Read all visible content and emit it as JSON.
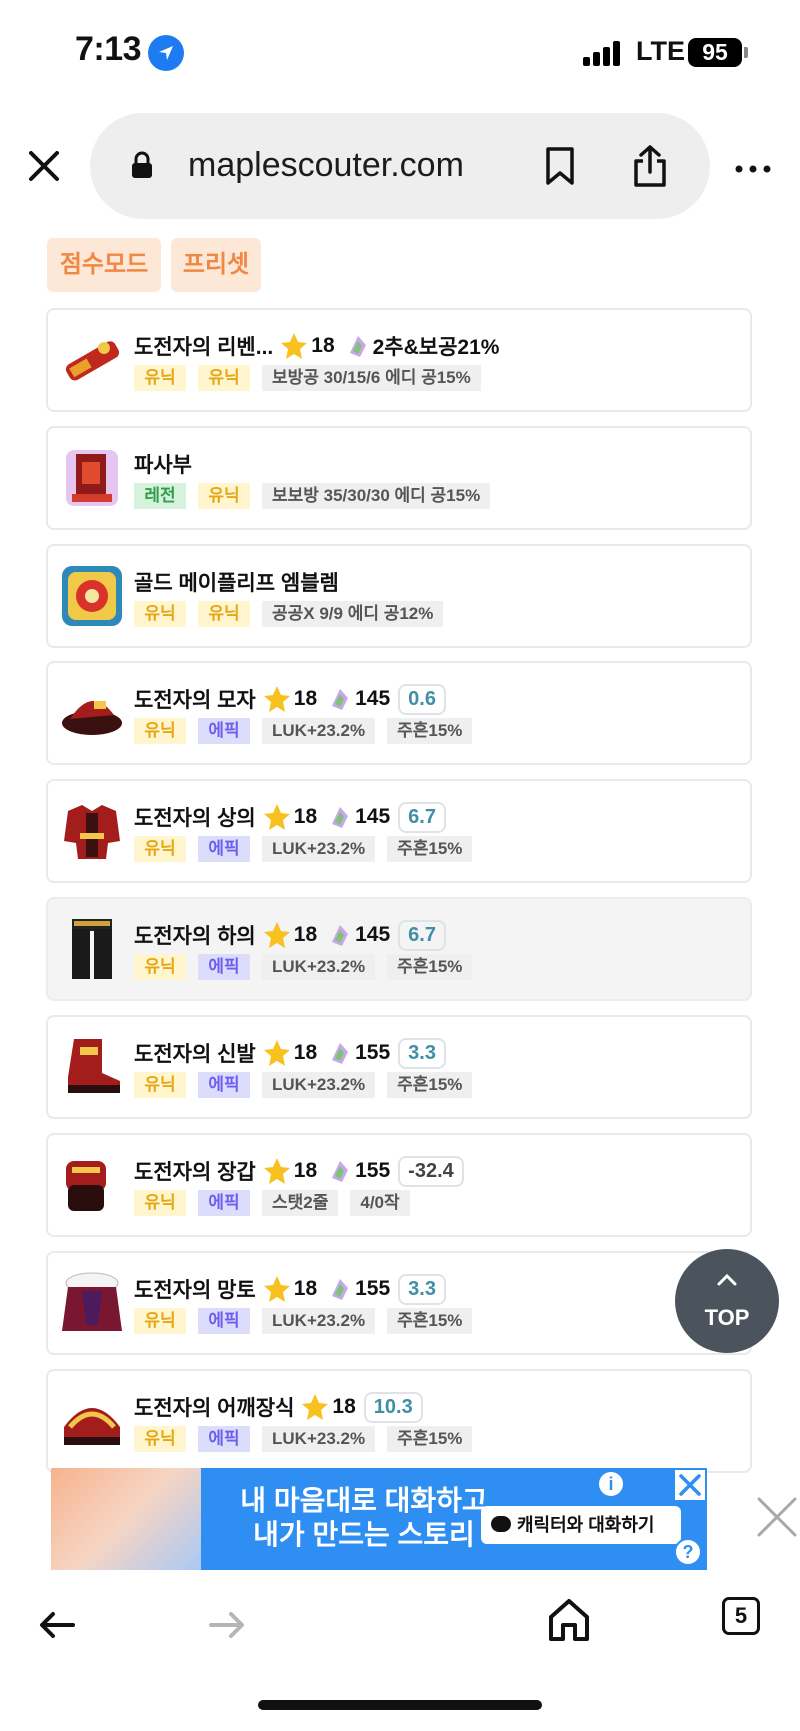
{
  "status_bar": {
    "time": "7:13",
    "network": "LTE",
    "battery": "95"
  },
  "browser": {
    "url": "maplescouter.com",
    "tab_count": "5"
  },
  "modes": [
    {
      "label": "점수모드"
    },
    {
      "label": "프리셋"
    }
  ],
  "items": [
    {
      "name": "도전자의 리벤...",
      "icon": "weapon-icon",
      "star": "18",
      "gem": "",
      "extra": "2추&보공21%",
      "score": "",
      "tags": [
        {
          "text": "유닉",
          "type": "unique"
        },
        {
          "text": "유닉",
          "type": "unique"
        },
        {
          "text": "보방공 30/15/6 에디 공15%",
          "type": "info"
        }
      ]
    },
    {
      "name": "파사부",
      "icon": "secondary-weapon-icon",
      "star": "",
      "gem": "",
      "extra": "",
      "score": "",
      "tags": [
        {
          "text": "레전",
          "type": "legend"
        },
        {
          "text": "유닉",
          "type": "unique"
        },
        {
          "text": "보보방 35/30/30 에디 공15%",
          "type": "info"
        }
      ]
    },
    {
      "name": "골드 메이플리프 엠블렘",
      "icon": "emblem-icon",
      "star": "",
      "gem": "",
      "extra": "",
      "score": "",
      "tags": [
        {
          "text": "유닉",
          "type": "unique"
        },
        {
          "text": "유닉",
          "type": "unique"
        },
        {
          "text": "공공X 9/9 에디 공12%",
          "type": "info"
        }
      ]
    },
    {
      "name": "도전자의 모자",
      "icon": "hat-icon",
      "star": "18",
      "gem": "145",
      "extra": "",
      "score": "0.6",
      "tags": [
        {
          "text": "유닉",
          "type": "unique"
        },
        {
          "text": "에픽",
          "type": "epic"
        },
        {
          "text": "LUK+23.2%",
          "type": "info"
        },
        {
          "text": "주흔15%",
          "type": "info"
        }
      ]
    },
    {
      "name": "도전자의 상의",
      "icon": "top-armor-icon",
      "star": "18",
      "gem": "145",
      "extra": "",
      "score": "6.7",
      "tags": [
        {
          "text": "유닉",
          "type": "unique"
        },
        {
          "text": "에픽",
          "type": "epic"
        },
        {
          "text": "LUK+23.2%",
          "type": "info"
        },
        {
          "text": "주흔15%",
          "type": "info"
        }
      ]
    },
    {
      "name": "도전자의 하의",
      "icon": "bottom-armor-icon",
      "star": "18",
      "gem": "145",
      "extra": "",
      "score": "6.7",
      "tags": [
        {
          "text": "유닉",
          "type": "unique"
        },
        {
          "text": "에픽",
          "type": "epic"
        },
        {
          "text": "LUK+23.2%",
          "type": "info"
        },
        {
          "text": "주흔15%",
          "type": "info"
        }
      ]
    },
    {
      "name": "도전자의 신발",
      "icon": "shoes-icon",
      "star": "18",
      "gem": "155",
      "extra": "",
      "score": "3.3",
      "tags": [
        {
          "text": "유닉",
          "type": "unique"
        },
        {
          "text": "에픽",
          "type": "epic"
        },
        {
          "text": "LUK+23.2%",
          "type": "info"
        },
        {
          "text": "주흔15%",
          "type": "info"
        }
      ]
    },
    {
      "name": "도전자의 장갑",
      "icon": "gloves-icon",
      "star": "18",
      "gem": "155",
      "extra": "",
      "score": "-32.4",
      "tags": [
        {
          "text": "유닉",
          "type": "unique"
        },
        {
          "text": "에픽",
          "type": "epic"
        },
        {
          "text": "스탯2줄",
          "type": "info"
        },
        {
          "text": "4/0작",
          "type": "info"
        }
      ]
    },
    {
      "name": "도전자의 망토",
      "icon": "cape-icon",
      "star": "18",
      "gem": "155",
      "extra": "",
      "score": "3.3",
      "tags": [
        {
          "text": "유닉",
          "type": "unique"
        },
        {
          "text": "에픽",
          "type": "epic"
        },
        {
          "text": "LUK+23.2%",
          "type": "info"
        },
        {
          "text": "주흔15%",
          "type": "info"
        }
      ]
    },
    {
      "name": "도전자의 어깨장식",
      "icon": "shoulder-icon",
      "star": "18",
      "gem": "",
      "extra": "",
      "score": "10.3",
      "tags": [
        {
          "text": "유닉",
          "type": "unique"
        },
        {
          "text": "에픽",
          "type": "epic"
        },
        {
          "text": "LUK+23.2%",
          "type": "info"
        },
        {
          "text": "주흔15%",
          "type": "info"
        }
      ]
    }
  ],
  "top_button": {
    "label": "TOP"
  },
  "ad": {
    "line1": "내 마음대로 대화하고",
    "line2": "내가 만드는 스토리",
    "cta": "캐릭터와 대화하기",
    "info": "i",
    "help": "?"
  },
  "colors": {
    "accent": "#f28744",
    "score": "#3f8fa5",
    "top_button": "#4b545c",
    "ad_bg": "#2f8ef2"
  }
}
